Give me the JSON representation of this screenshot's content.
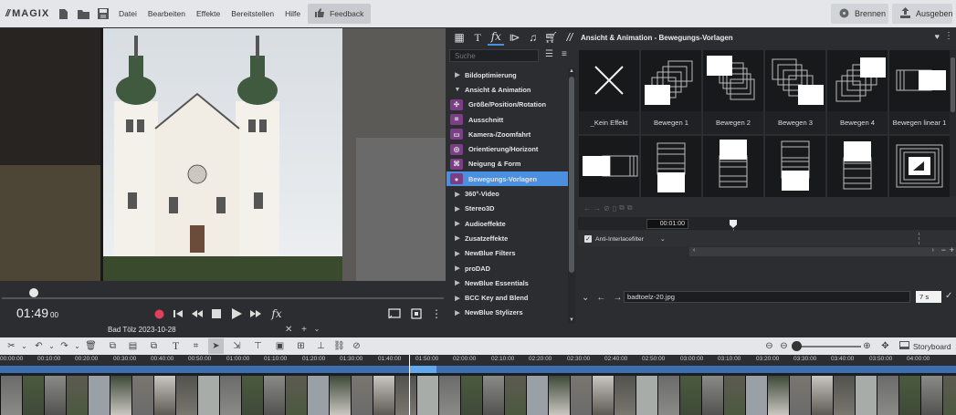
{
  "app": {
    "logo_text": "MAGIX"
  },
  "menu": [
    "Datei",
    "Bearbeiten",
    "Effekte",
    "Bereitstellen",
    "Hilfe"
  ],
  "feedback_label": "Feedback",
  "burn_label": "Brennen",
  "export_label": "Ausgeben",
  "preview": {
    "timecode": "01:49",
    "frames": "00"
  },
  "effects": {
    "search_placeholder": "Suche",
    "items": [
      {
        "label": "Bildoptimierung",
        "type": "group",
        "expanded": false
      },
      {
        "label": "Ansicht & Animation",
        "type": "group",
        "expanded": true
      },
      {
        "label": "Größe/Position/Rotation",
        "type": "sub"
      },
      {
        "label": "Ausschnitt",
        "type": "sub"
      },
      {
        "label": "Kamera-/Zoomfahrt",
        "type": "sub"
      },
      {
        "label": "Orientierung/Horizont",
        "type": "sub"
      },
      {
        "label": "Neigung & Form",
        "type": "sub"
      },
      {
        "label": "Bewegungs-Vorlagen",
        "type": "sub",
        "selected": true
      },
      {
        "label": "360°-Video",
        "type": "group",
        "expanded": false
      },
      {
        "label": "Stereo3D",
        "type": "group",
        "expanded": false
      },
      {
        "label": "Audioeffekte",
        "type": "group",
        "expanded": false
      },
      {
        "label": "Zusatzeffekte",
        "type": "group",
        "expanded": false
      },
      {
        "label": "NewBlue Filters",
        "type": "group",
        "expanded": false
      },
      {
        "label": "proDAD",
        "type": "group",
        "expanded": false
      },
      {
        "label": "NewBlue Essentials",
        "type": "group",
        "expanded": false
      },
      {
        "label": "BCC Key and Blend",
        "type": "group",
        "expanded": false
      },
      {
        "label": "NewBlue Stylizers",
        "type": "group",
        "expanded": false
      }
    ]
  },
  "templates": {
    "title": "Ansicht & Animation - Bewegungs-Vorlagen",
    "row1": [
      "_Kein Effekt",
      "Bewegen 1",
      "Bewegen 2",
      "Bewegen 3",
      "Bewegen 4",
      "Bewegen linear 1"
    ]
  },
  "keyframes": {
    "time": "00:01:00",
    "antiinterlace_label": "Anti-Interlacefilter"
  },
  "object": {
    "filename": "badtoelz-20.jpg",
    "duration": "7 s"
  },
  "project": {
    "tab_label": "Bad Tölz 2023-10-28"
  },
  "timeline": {
    "storyboard_label": "Storyboard",
    "ruler": [
      "00:00:00",
      "00:10:00",
      "00:20:00",
      "00:30:00",
      "00:40:00",
      "00:50:00",
      "01:00:00",
      "01:10:00",
      "01:20:00",
      "01:30:00",
      "01:40:00",
      "01:50:00",
      "02:00:00",
      "02:10:00",
      "02:20:00",
      "02:30:00",
      "02:40:00",
      "02:50:00",
      "03:00:00",
      "03:10:00",
      "03:20:00",
      "03:30:00",
      "03:40:00",
      "03:50:00",
      "04:00:00"
    ]
  },
  "colors": {
    "accent": "#4b8fe0",
    "record": "#e0405a",
    "effect_icon": "#7c3f86"
  }
}
